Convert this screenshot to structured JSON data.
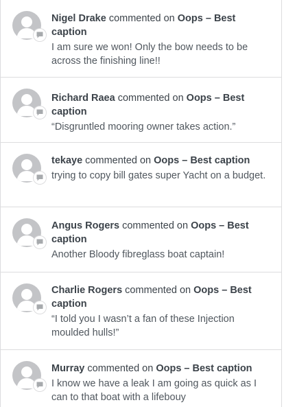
{
  "comments": [
    {
      "author": "Nigel Drake",
      "action": " commented on ",
      "post": "Oops – Best caption",
      "text": "I am sure we won! Only the bow needs to be across the finishing line!!"
    },
    {
      "author": "Richard Raea",
      "action": " commented on ",
      "post": "Oops – Best caption",
      "text": "“Disgruntled mooring owner takes action.”"
    },
    {
      "author": "tekaye",
      "action": " commented on ",
      "post": "Oops – Best caption",
      "text": "trying to copy bill gates super Yacht on a budget."
    },
    {
      "author": "Angus Rogers",
      "action": " commented on ",
      "post": "Oops – Best caption",
      "text": "Another Bloody fibreglass boat captain!"
    },
    {
      "author": "Charlie Rogers",
      "action": " commented on ",
      "post": "Oops – Best caption",
      "text": "“I told you I wasn’t a fan of these Injection moulded hulls!”"
    },
    {
      "author": "Murray",
      "action": " commented on ",
      "post": "Oops – Best caption",
      "text": "I know we have a leak I am going as quick as I can to that boat with a lifebouy"
    }
  ],
  "icons": {
    "avatar": "default-avatar-icon",
    "badge": "comment-bubble-icon"
  },
  "colors": {
    "avatar_bg": "#c3c4c7",
    "avatar_fg": "#ffffff",
    "badge_icon": "#a7aaad",
    "divider": "#dcdcde",
    "text": "#3c434a"
  }
}
